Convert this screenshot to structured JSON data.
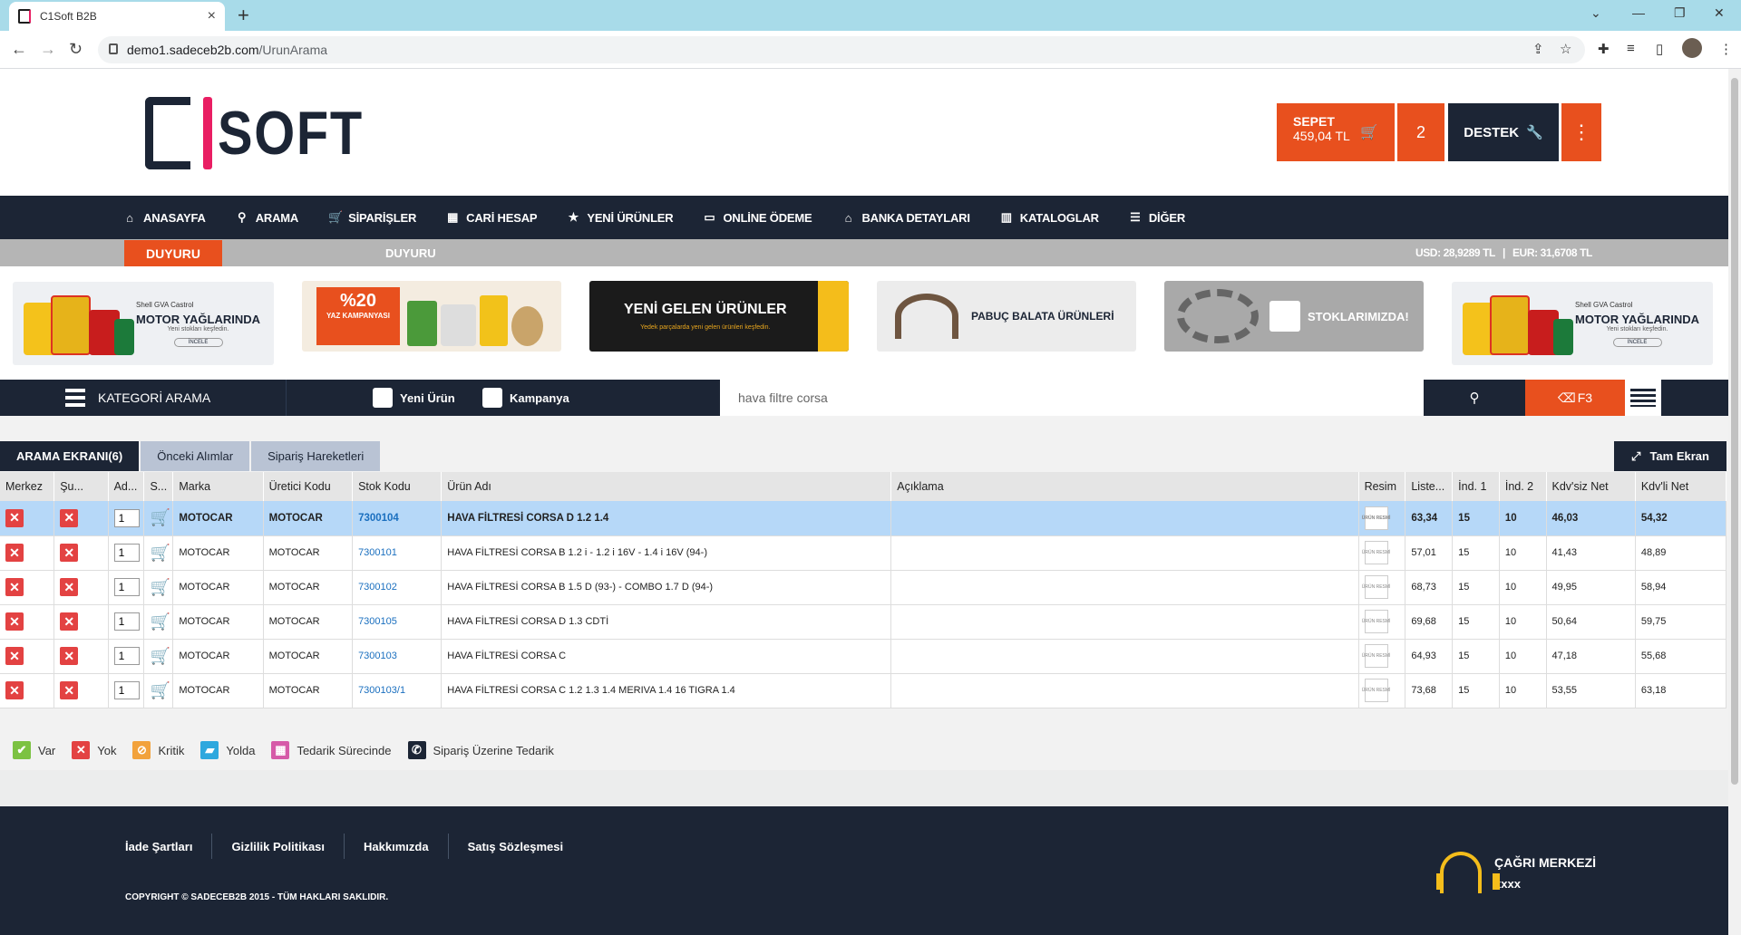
{
  "browser": {
    "tab_title": "C1Soft B2B",
    "url_host": "demo1.sadeceb2b.com",
    "url_path": "/UrunArama"
  },
  "header": {
    "logo_text": "SOFT",
    "cart_label": "SEPET",
    "cart_amount": "459,04 TL",
    "cart_count": "2",
    "support_label": "DESTEK"
  },
  "nav": [
    {
      "label": "ANASAYFA",
      "icon": "home-icon"
    },
    {
      "label": "ARAMA",
      "icon": "search-icon"
    },
    {
      "label": "SİPARİŞLER",
      "icon": "cart-icon"
    },
    {
      "label": "CARİ HESAP",
      "icon": "calculator-icon"
    },
    {
      "label": "YENİ ÜRÜNLER",
      "icon": "star-icon"
    },
    {
      "label": "ONLİNE ÖDEME",
      "icon": "credit-card-icon"
    },
    {
      "label": "BANKA DETAYLARI",
      "icon": "bank-icon"
    },
    {
      "label": "KATALOGLAR",
      "icon": "map-icon"
    },
    {
      "label": "DİĞER",
      "icon": "list-icon"
    }
  ],
  "announcement": {
    "label": "DUYURU",
    "text": "DUYURU",
    "usd": "USD: 28,9289 TL",
    "eur": "EUR: 31,6708 TL"
  },
  "banners": {
    "oil_title": "MOTOR YAĞLARINDA",
    "oil_sub": "Yeni stokları keşfedin.",
    "oil_brands": "Shell  GVA  Castrol",
    "oil_btn": "İNCELE",
    "camp_big": "%20",
    "camp_small": "YAZ KAMPANYASI",
    "new_title": "YENİ GELEN ÜRÜNLER",
    "new_sub": "Yedek parçalarda yeni gelen ürünleri keşfedin.",
    "brake_title": "PABUÇ BALATA ÜRÜNLERİ",
    "stock_title": "STOKLARIMIZDA!"
  },
  "search": {
    "category_label": "KATEGORİ ARAMA",
    "new_product": "Yeni Ürün",
    "campaign": "Kampanya",
    "query": "hava filtre corsa",
    "f3_label": "F3"
  },
  "tabs": [
    "ARAMA EKRANI(6)",
    "Önceki Alımlar",
    "Sipariş Hareketleri"
  ],
  "fullscreen_label": "Tam Ekran",
  "table": {
    "headers": [
      "Merkez",
      "Şu...",
      "Ad...",
      "S...",
      "Marka",
      "Üretici Kodu",
      "Stok Kodu",
      "Ürün Adı",
      "Açıklama",
      "Resim",
      "Liste...",
      "İnd. 1",
      "İnd. 2",
      "Kdv'siz Net",
      "Kdv'li Net"
    ],
    "rows": [
      {
        "qty": "1",
        "marka": "MOTOCAR",
        "uretici": "MOTOCAR",
        "stok": "7300104",
        "urun": "HAVA FİLTRESİ CORSA D 1.2 1.4",
        "aciklama": "",
        "liste": "63,34",
        "ind1": "15",
        "ind2": "10",
        "kdvsiz": "46,03",
        "kdvli": "54,32"
      },
      {
        "qty": "1",
        "marka": "MOTOCAR",
        "uretici": "MOTOCAR",
        "stok": "7300101",
        "urun": "HAVA FİLTRESİ CORSA B 1.2 i - 1.2 i 16V - 1.4 i 16V (94-)",
        "aciklama": "",
        "liste": "57,01",
        "ind1": "15",
        "ind2": "10",
        "kdvsiz": "41,43",
        "kdvli": "48,89"
      },
      {
        "qty": "1",
        "marka": "MOTOCAR",
        "uretici": "MOTOCAR",
        "stok": "7300102",
        "urun": "HAVA FİLTRESİ CORSA B 1.5 D (93-) - COMBO 1.7 D (94-)",
        "aciklama": "",
        "liste": "68,73",
        "ind1": "15",
        "ind2": "10",
        "kdvsiz": "49,95",
        "kdvli": "58,94"
      },
      {
        "qty": "1",
        "marka": "MOTOCAR",
        "uretici": "MOTOCAR",
        "stok": "7300105",
        "urun": "HAVA FİLTRESİ CORSA D 1.3 CDTİ",
        "aciklama": "",
        "liste": "69,68",
        "ind1": "15",
        "ind2": "10",
        "kdvsiz": "50,64",
        "kdvli": "59,75"
      },
      {
        "qty": "1",
        "marka": "MOTOCAR",
        "uretici": "MOTOCAR",
        "stok": "7300103",
        "urun": "HAVA FİLTRESİ CORSA C",
        "aciklama": "",
        "liste": "64,93",
        "ind1": "15",
        "ind2": "10",
        "kdvsiz": "47,18",
        "kdvli": "55,68"
      },
      {
        "qty": "1",
        "marka": "MOTOCAR",
        "uretici": "MOTOCAR",
        "stok": "7300103/1",
        "urun": "HAVA FİLTRESİ CORSA C 1.2 1.3 1.4 MERIVA 1.4 16 TIGRA 1.4",
        "aciklama": "",
        "liste": "73,68",
        "ind1": "15",
        "ind2": "10",
        "kdvsiz": "53,55",
        "kdvli": "63,18"
      }
    ],
    "image_placeholder": "ÜRÜN RESMİ"
  },
  "legend": [
    {
      "label": "Var",
      "color": "#7cc242",
      "icon": "check-icon",
      "glyph": "✔"
    },
    {
      "label": "Yok",
      "color": "#e34242",
      "icon": "x-icon",
      "glyph": "✕"
    },
    {
      "label": "Kritik",
      "color": "#f2a23c",
      "icon": "ban-icon",
      "glyph": "⊘"
    },
    {
      "label": "Yolda",
      "color": "#2ea8de",
      "icon": "truck-icon",
      "glyph": "▰"
    },
    {
      "label": "Tedarik Sürecinde",
      "color": "#d65aa8",
      "icon": "calendar-icon",
      "glyph": "▦"
    },
    {
      "label": "Sipariş Üzerine Tedarik",
      "color": "#1c2535",
      "icon": "phone-icon",
      "glyph": "✆"
    }
  ],
  "footer": {
    "links": [
      "İade Şartları",
      "Gizlilik Politikası",
      "Hakkımızda",
      "Satış Sözleşmesi"
    ],
    "copyright": "COPYRIGHT © SADECEB2B 2015 - TÜM HAKLARI SAKLIDIR.",
    "call_title": "ÇAĞRI MERKEZİ",
    "call_number": "xxxx"
  },
  "colors": {
    "brand_orange": "#e8501e",
    "brand_navy": "#1c2535",
    "selected_row": "#b6d8f8"
  }
}
